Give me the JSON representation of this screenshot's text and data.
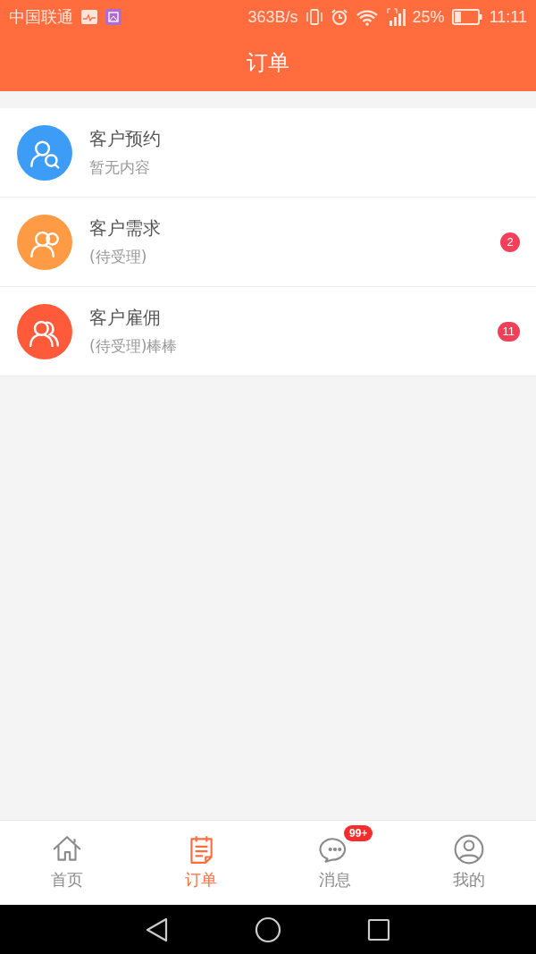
{
  "status_bar": {
    "carrier": "中国联通",
    "speed": "363B/s",
    "battery": "25%",
    "time": "11:11"
  },
  "header": {
    "title": "订单"
  },
  "orders": [
    {
      "kind": "search",
      "color": "#3d9df6",
      "title": "客户预约",
      "subtitle": "暂无内容"
    },
    {
      "kind": "bubble",
      "color": "#ff9a45",
      "title": "客户需求",
      "subtitle": "(待受理)",
      "badge": "2"
    },
    {
      "kind": "group",
      "color": "#ff5a3a",
      "title": "客户雇佣",
      "subtitle": "(待受理)棒棒",
      "badge": "11"
    }
  ],
  "tabs": [
    {
      "kind": "home",
      "label": "首页",
      "selected": false
    },
    {
      "kind": "orders",
      "label": "订单",
      "selected": true
    },
    {
      "kind": "messages",
      "label": "消息",
      "selected": false,
      "badge": "99+"
    },
    {
      "kind": "profile",
      "label": "我的",
      "selected": false
    }
  ]
}
